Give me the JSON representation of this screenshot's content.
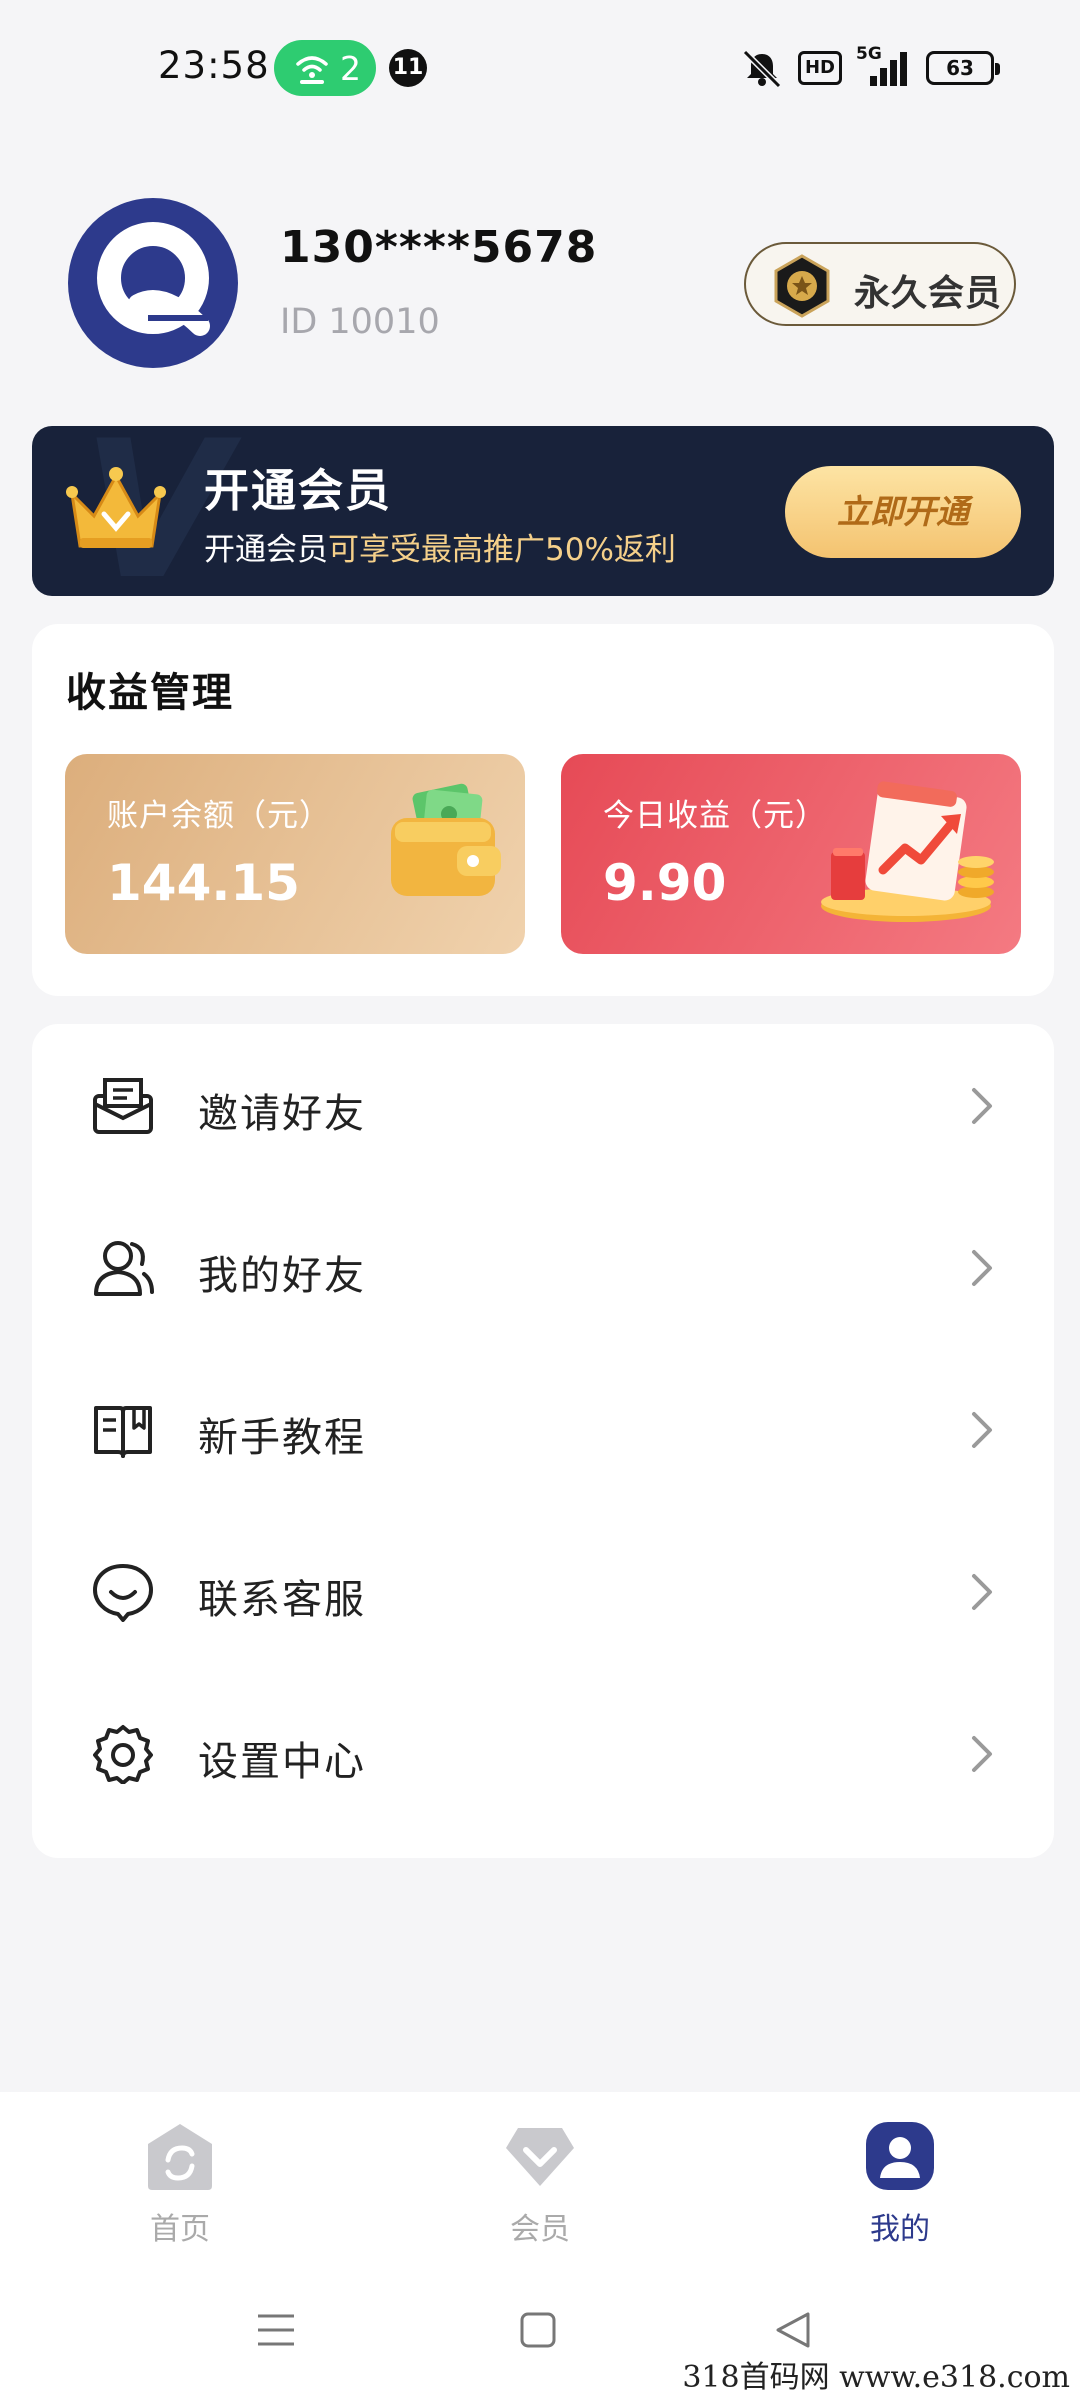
{
  "status_bar": {
    "time": "23:58",
    "hotspot_count": "2",
    "notification_count": "11",
    "hd_label": "HD",
    "network": "5G",
    "battery": "63"
  },
  "profile": {
    "phone": "130****5678",
    "user_id": "ID 10010",
    "badge_label": "永久会员"
  },
  "member_banner": {
    "title": "开通会员",
    "subtitle_prefix": "开通会员",
    "subtitle_highlight": "可享受最高推广50%返利",
    "button_label": "立即开通"
  },
  "earnings": {
    "title": "收益管理",
    "balance_label": "账户余额（元）",
    "balance_value": "144.15",
    "today_label": "今日收益（元）",
    "today_value": "9.90"
  },
  "menu": {
    "items": [
      {
        "label": "邀请好友",
        "icon": "envelope-icon"
      },
      {
        "label": "我的好友",
        "icon": "friends-icon"
      },
      {
        "label": "新手教程",
        "icon": "book-icon"
      },
      {
        "label": "联系客服",
        "icon": "chat-bubble-icon"
      },
      {
        "label": "设置中心",
        "icon": "gear-icon"
      }
    ]
  },
  "bottom_nav": {
    "items": [
      {
        "label": "首页",
        "icon": "home-icon",
        "active": false
      },
      {
        "label": "会员",
        "icon": "diamond-icon",
        "active": false
      },
      {
        "label": "我的",
        "icon": "user-icon",
        "active": true
      }
    ]
  },
  "watermark": "318首码网  www.e318.com",
  "colors": {
    "brand_navy": "#2d3a8c",
    "banner_bg": "#18223a",
    "gold": "#f5d08a",
    "balance_tile": "#e3b98a",
    "today_tile": "#ee5f69"
  }
}
